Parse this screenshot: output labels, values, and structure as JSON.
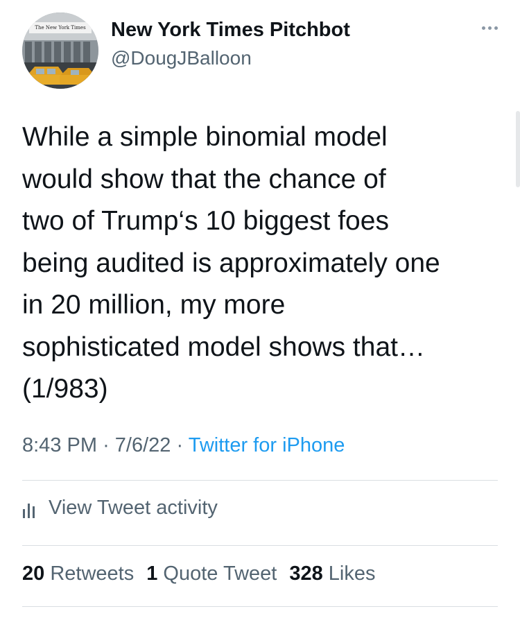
{
  "author": {
    "avatar_icon": "nyt-building-taxi-avatar",
    "avatar_logo_text": "The New York Times",
    "display_name": "New York Times Pitchbot",
    "handle": "@DougJBalloon"
  },
  "menu": {
    "more_icon": "more-options-icon"
  },
  "tweet": {
    "text": "While a simple binomial model\nwould show that the chance of\ntwo of Trump‘s 10 biggest foes\nbeing audited is approximately one\nin 20 million, my more\nsophisticated model shows that…\n(1/983)",
    "time": "8:43 PM",
    "separator": "·",
    "date": "7/6/22",
    "source": "Twitter for iPhone"
  },
  "activity": {
    "icon": "activity-bars-icon",
    "label": "View Tweet activity"
  },
  "stats": {
    "retweets_count": "20",
    "retweets_label": "Retweets",
    "quotes_count": "1",
    "quotes_label": "Quote Tweet",
    "likes_count": "328",
    "likes_label": "Likes"
  },
  "colors": {
    "text": "#0f1419",
    "secondary": "#536471",
    "link": "#1d9bf0",
    "divider": "#d9dee2"
  }
}
